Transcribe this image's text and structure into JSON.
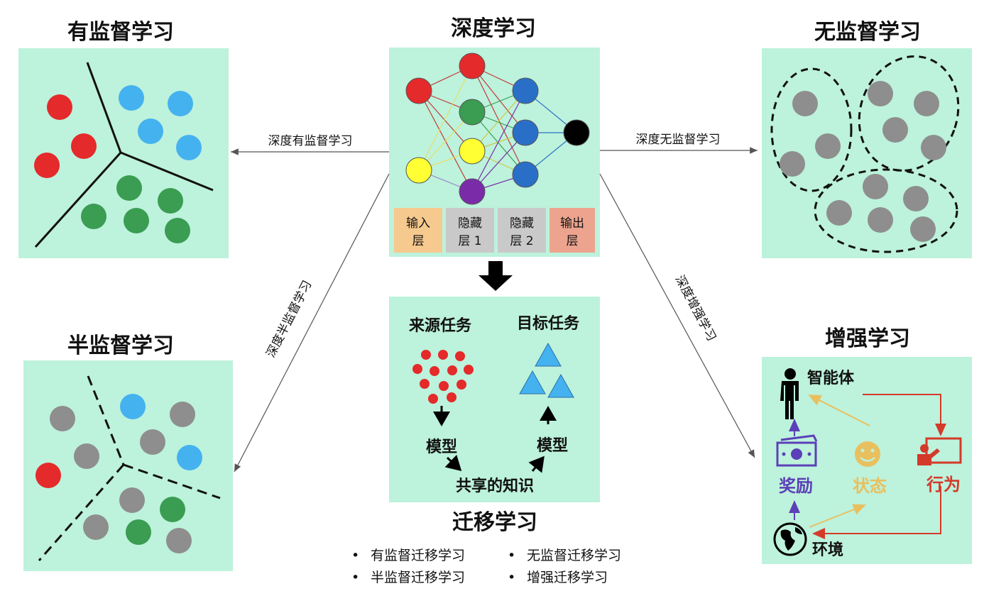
{
  "colors": {
    "panel": "#bdf2dc",
    "red": "#e42a2a",
    "blue": "#45b2f0",
    "green": "#3a9d52",
    "gray": "#8e8e8e",
    "yellow": "#ffff33",
    "purple": "#7a2ca8",
    "navy": "#2a6fc7",
    "black": "#000000",
    "reward": "#5c40b8",
    "state": "#e8c060",
    "action": "#d43a2a"
  },
  "supervised": {
    "title": "有监督学习"
  },
  "unsupervised": {
    "title": "无监督学习"
  },
  "semi": {
    "title": "半监督学习"
  },
  "deep": {
    "title": "深度学习",
    "layers": [
      {
        "line1": "输入",
        "line2": "层"
      },
      {
        "line1": "隐藏",
        "line2": "层 1"
      },
      {
        "line1": "隐藏",
        "line2": "层 2"
      },
      {
        "line1": "输出",
        "line2": "层"
      }
    ]
  },
  "arrows": {
    "deep_supervised": "深度有监督学习",
    "deep_unsupervised": "深度无监督学习",
    "deep_semi": "深度半监督学习",
    "deep_rl": "深度增强学习"
  },
  "transfer": {
    "source_task": "来源任务",
    "target_task": "目标任务",
    "model_left": "模型",
    "model_right": "模型",
    "shared": "共享的知识",
    "title": "迁移学习",
    "bullets": [
      "有监督迁移学习",
      "无监督迁移学习",
      "半监督迁移学习",
      "增强迁移学习"
    ]
  },
  "rl": {
    "title": "增强学习",
    "agent": "智能体",
    "reward": "奖励",
    "state": "状态",
    "action": "行为",
    "environment": "环境"
  }
}
